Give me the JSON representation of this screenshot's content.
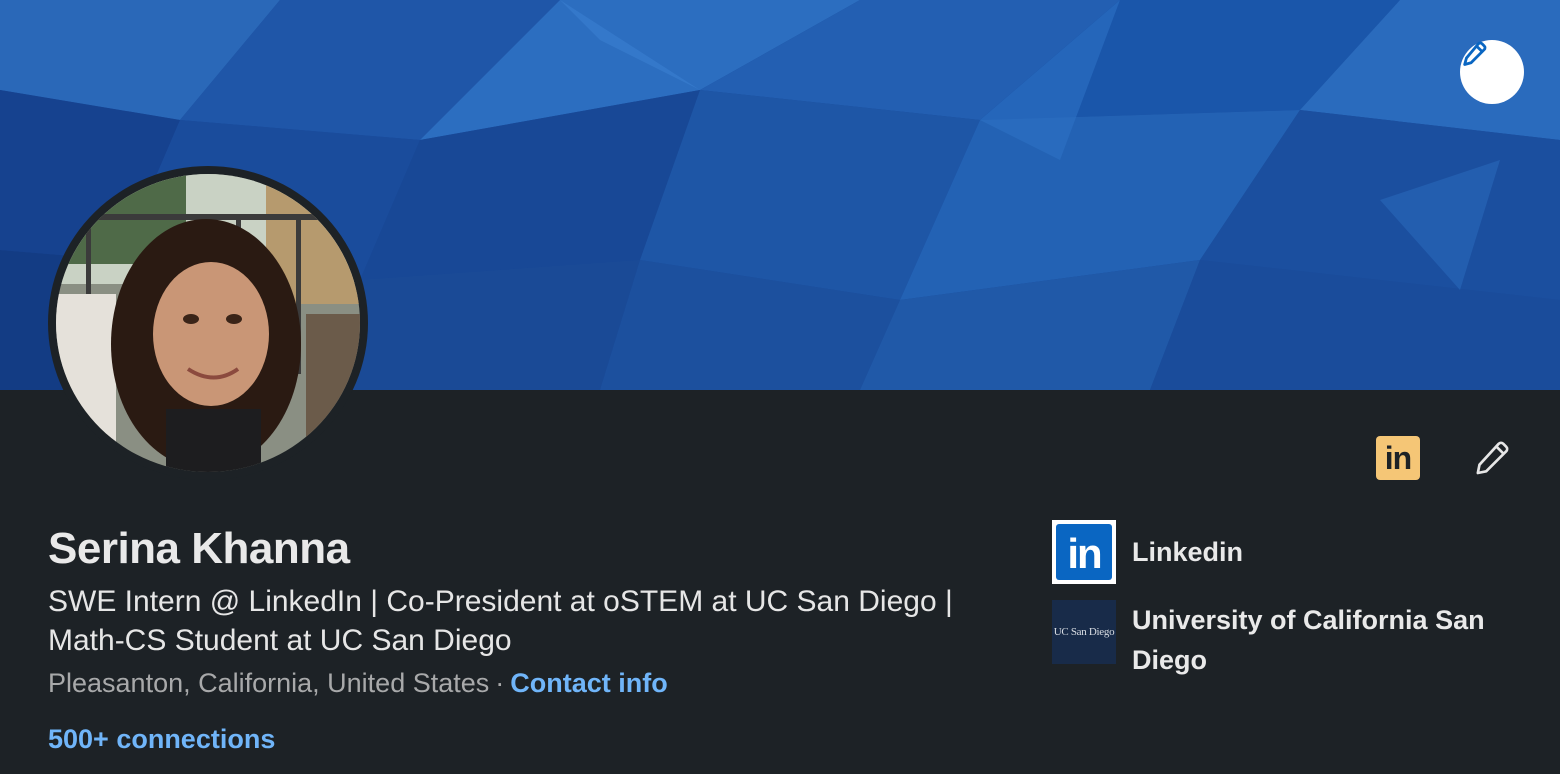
{
  "profile": {
    "name": "Serina Khanna",
    "headline": "SWE Intern @ LinkedIn | Co-President at oSTEM at UC San Diego | Math-CS Student at UC San Diego",
    "location": "Pleasanton, California, United States",
    "separator": "·",
    "contact_label": "Contact info",
    "connections_label": "500+ connections"
  },
  "orgs": [
    {
      "label": "Linkedin",
      "logo_text": "in"
    },
    {
      "label": "University of California San Diego",
      "logo_text": "UC San Diego"
    }
  ],
  "actions": {
    "linkedin_badge_text": "in"
  },
  "icons": {
    "banner_edit": "pencil-icon",
    "profile_edit": "pencil-icon",
    "linkedin_badge": "linkedin-icon"
  },
  "colors": {
    "background": "#1d2226",
    "banner_base": "#1c4ea0",
    "link": "#70b5f9",
    "linkedin_blue": "#0a66c2",
    "badge": "#f5c676"
  }
}
